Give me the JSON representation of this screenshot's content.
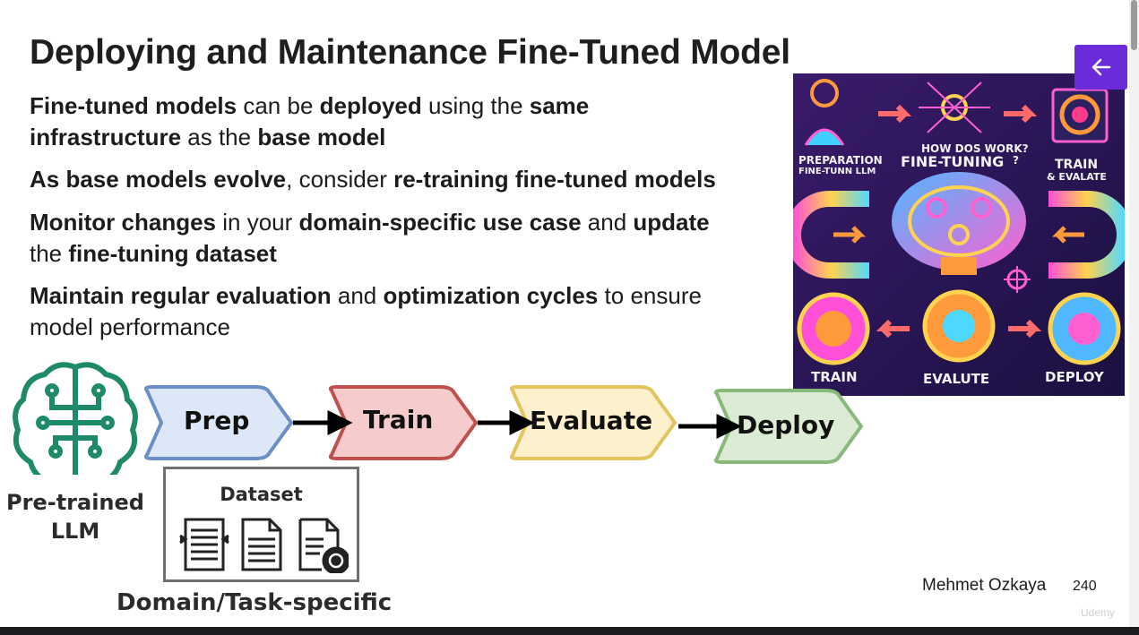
{
  "title": "Deploying and Maintenance Fine-Tuned Model",
  "bullets": [
    {
      "line1": [
        {
          "t": "Fine-tuned models",
          "b": true
        },
        {
          "t": " can be ",
          "b": false
        },
        {
          "t": "deployed",
          "b": true
        },
        {
          "t": " using the ",
          "b": false
        },
        {
          "t": "same",
          "b": true
        }
      ],
      "line2": [
        {
          "t": "infrastructure",
          "b": true
        },
        {
          "t": " as the ",
          "b": false
        },
        {
          "t": "base model",
          "b": true
        }
      ]
    },
    {
      "line1": [
        {
          "t": "As base models evolve",
          "b": true
        },
        {
          "t": ", consider ",
          "b": false
        },
        {
          "t": "re-training fine-tuned models",
          "b": true
        }
      ],
      "line2": []
    },
    {
      "line1": [
        {
          "t": "Monitor changes",
          "b": true
        },
        {
          "t": " in your ",
          "b": false
        },
        {
          "t": "domain-specific use case",
          "b": true
        },
        {
          "t": " and ",
          "b": false
        },
        {
          "t": "update",
          "b": true
        }
      ],
      "line2": [
        {
          "t": "the ",
          "b": false
        },
        {
          "t": "fine-tuning dataset",
          "b": true
        }
      ]
    },
    {
      "line1": [
        {
          "t": "Maintain regular evaluation",
          "b": true
        },
        {
          "t": " and ",
          "b": false
        },
        {
          "t": "optimization cycles",
          "b": true
        },
        {
          "t": " to ensure",
          "b": false
        }
      ],
      "line2": [
        {
          "t": "model performance",
          "b": false
        }
      ]
    }
  ],
  "illustration": {
    "preparation": "PREPARATION",
    "preparation_sub": "FINE-TUNN LLM",
    "question": "HOW DOS WORK?",
    "center": "FINE-TUNING",
    "qmark": "?",
    "train_top": "TRAIN",
    "evaluate_top": "& EVALATE",
    "train_bottom": "TRAIN",
    "evaluate_bottom": "EVALUTE",
    "deploy_bottom": "DEPLOY"
  },
  "pipeline": {
    "stages": [
      {
        "label": "Prep",
        "fill": "#dce8f7",
        "stroke": "#6a8fc4"
      },
      {
        "label": "Train",
        "fill": "#f5cccb",
        "stroke": "#c0504d"
      },
      {
        "label": "Evaluate",
        "fill": "#fdf1cd",
        "stroke": "#e3c45c"
      },
      {
        "label": "Deploy",
        "fill": "#dcebd3",
        "stroke": "#88b87a"
      }
    ],
    "source_label_line1": "Pre-trained",
    "source_label_line2": "LLM",
    "dataset_title": "Dataset",
    "dataset_caption": "Domain/Task-specific"
  },
  "footer": {
    "author": "Mehmet Ozkaya",
    "page": "240",
    "watermark": "Udemy"
  },
  "colors": {
    "accent": "#6c2bd9",
    "llm_icon": "#1f8a6a"
  },
  "icons": {
    "back": "arrow-left-icon",
    "llm": "brain-circuit-icon"
  }
}
